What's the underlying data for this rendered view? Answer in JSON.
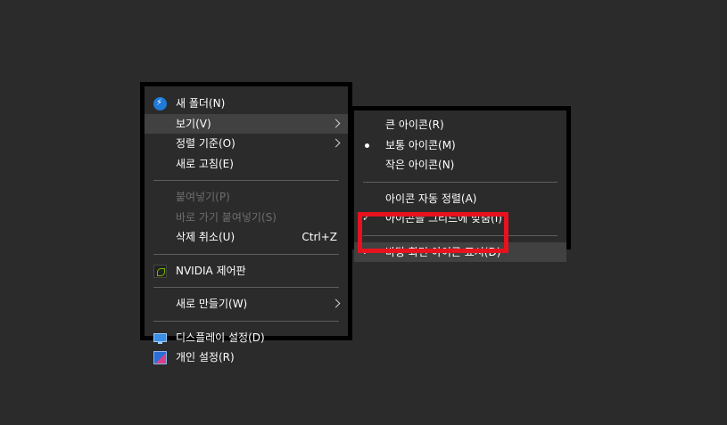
{
  "main_menu": {
    "items": [
      {
        "label": "새 폴더(N)",
        "icon": "new-folder-icon"
      },
      {
        "label": "보기(V)",
        "has_submenu": true
      },
      {
        "label": "정렬 기준(O)",
        "has_submenu": true
      },
      {
        "label": "새로 고침(E)"
      },
      {
        "label": "붙여넣기(P)",
        "disabled": true
      },
      {
        "label": "바로 가기 붙여넣기(S)",
        "disabled": true
      },
      {
        "label": "삭제 취소(U)",
        "shortcut": "Ctrl+Z"
      },
      {
        "label": "NVIDIA 제어판",
        "icon": "nvidia-icon"
      },
      {
        "label": "새로 만들기(W)",
        "has_submenu": true
      },
      {
        "label": "디스플레이 설정(D)",
        "icon": "display-icon"
      },
      {
        "label": "개인 설정(R)",
        "icon": "personalize-icon"
      }
    ]
  },
  "view_submenu": {
    "items": [
      {
        "label": "큰 아이콘(R)"
      },
      {
        "label": "보통 아이콘(M)",
        "selected": true
      },
      {
        "label": "작은 아이콘(N)"
      },
      {
        "label": "아이콘 자동 정렬(A)"
      },
      {
        "label": "아이콘을 그리드에 맞춤(I)",
        "checked": true
      },
      {
        "label": "바탕 화면 아이콘 표시(D)",
        "checked": true
      }
    ]
  },
  "colors": {
    "background": "#2b2b2b",
    "menu_border": "#000000",
    "hover": "#414141",
    "disabled_text": "#6d6d6d",
    "highlight_box": "#e8121f"
  }
}
